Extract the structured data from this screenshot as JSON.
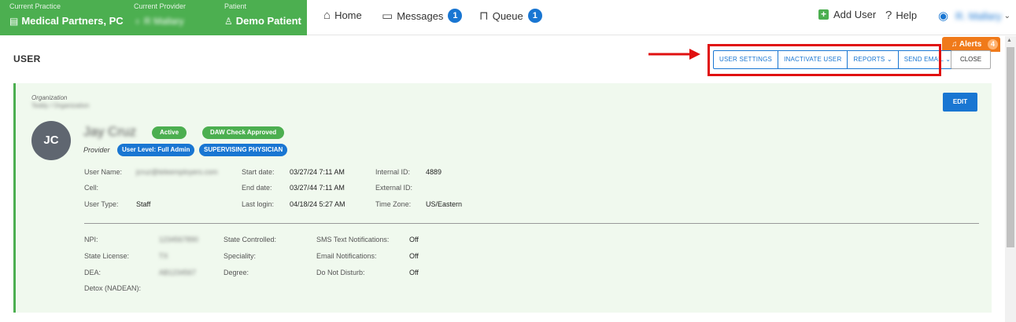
{
  "topbar": {
    "practice": {
      "label": "Current Practice",
      "value": "Medical Partners, PC",
      "icon": "building-icon"
    },
    "provider": {
      "label": "Current Provider",
      "value": "R Mallary",
      "icon": "stethoscope-icon"
    },
    "patient": {
      "label": "Patient",
      "value": "Demo Patient",
      "icon": "person-icon"
    },
    "nav": {
      "home": "Home",
      "messages": "Messages",
      "messages_count": "1",
      "queue": "Queue",
      "queue_count": "1"
    },
    "add_user": "Add User",
    "help": "Help",
    "user_name": "R. Mallary"
  },
  "alerts": {
    "label": "Alerts",
    "count": "4"
  },
  "header": {
    "title": "USER",
    "buttons": {
      "user_settings": "USER SETTINGS",
      "inactivate": "INACTIVATE USER",
      "reports": "REPORTS",
      "send_email": "SEND EMAIL"
    },
    "close": "CLOSE"
  },
  "card": {
    "org_label": "Organization",
    "org_value": "Teddy / Organization",
    "initials": "JC",
    "name": "Jay Cruz",
    "status": "Active",
    "daw": "DAW Check Approved",
    "role": "Provider",
    "user_level": "User Level: Full Admin",
    "supervising": "SUPERVISING PHYSICIAN",
    "edit": "EDIT",
    "fields": {
      "username_label": "User Name:",
      "username_value": "jcruz@teleemployers.com",
      "cell_label": "Cell:",
      "usertype_label": "User Type:",
      "usertype_value": "Staff",
      "start_label": "Start date:",
      "start_value": "03/27/24 7:11 AM",
      "end_label": "End date:",
      "end_value": "03/27/44 7:11 AM",
      "login_label": "Last login:",
      "login_value": "04/18/24 5:27 AM",
      "internal_label": "Internal ID:",
      "internal_value": "4889",
      "external_label": "External ID:",
      "tz_label": "Time Zone:",
      "tz_value": "US/Eastern"
    },
    "details": {
      "npi_label": "NPI:",
      "npi_value": "1234567890",
      "license_label": "State License:",
      "license_value": "TX",
      "dea_label": "DEA:",
      "dea_value": "AB1234567",
      "detox_label": "Detox (NADEAN):",
      "state_controlled_label": "State Controlled:",
      "speciality_label": "Speciality:",
      "degree_label": "Degree:",
      "sms_label": "SMS Text Notifications:",
      "sms_value": "Off",
      "email_label": "Email Notifications:",
      "email_value": "Off",
      "dnd_label": "Do Not Disturb:",
      "dnd_value": "Off"
    }
  },
  "colors": {
    "brand_green": "#4caf50",
    "primary_blue": "#1976d2",
    "alert_orange": "#f07a1a",
    "annotation_red": "#e01010"
  }
}
